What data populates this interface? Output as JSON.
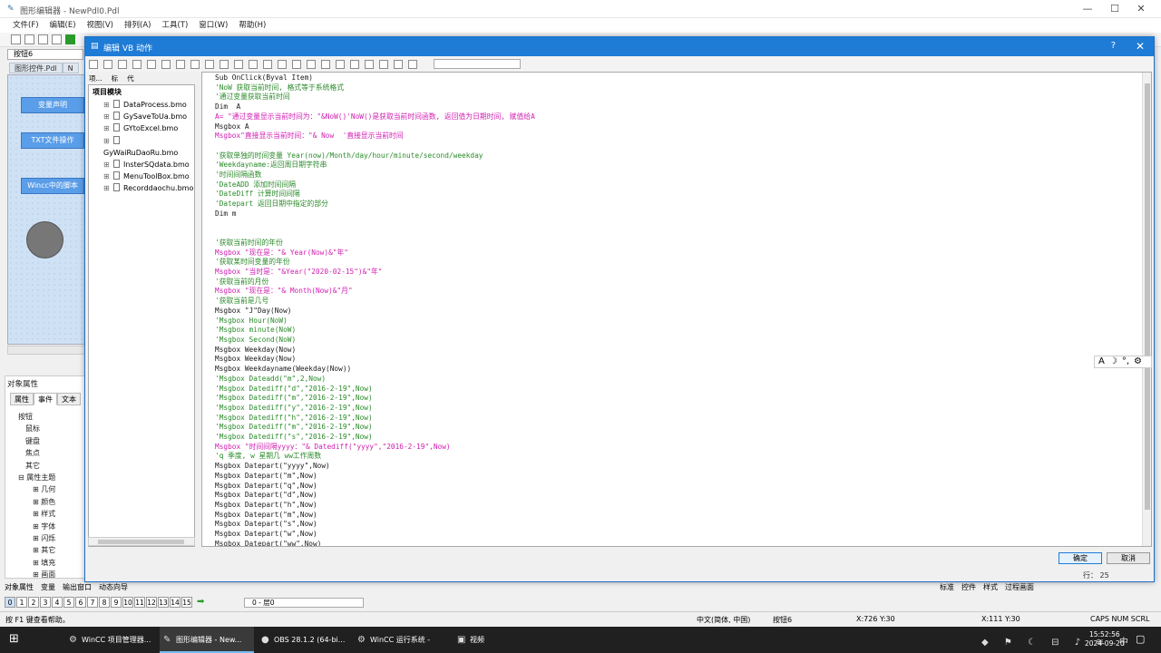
{
  "app": {
    "title": "图形编辑器 - NewPdl0.Pdl",
    "controls": {
      "minimize": "—",
      "maximize": "☐",
      "close": "✕"
    }
  },
  "menu": [
    "文件(F)",
    "编辑(E)",
    "视图(V)",
    "排列(A)",
    "工具(T)",
    "窗口(W)",
    "帮助(H)"
  ],
  "object_combo": "按钮6",
  "doc_tabs": [
    "图形控件.Pdl",
    "N"
  ],
  "canvas": {
    "buttons": [
      "变量声明",
      "TXT文件操作",
      "Wincc中的脚本"
    ]
  },
  "properties": {
    "title": "对象属性",
    "tabs": [
      "属性",
      "事件",
      "文本"
    ],
    "tree": [
      {
        "label": "按钮",
        "level": 1
      },
      {
        "label": "鼠标",
        "level": 2
      },
      {
        "label": "键盘",
        "level": 2
      },
      {
        "label": "焦点",
        "level": 2
      },
      {
        "label": "其它",
        "level": 2
      },
      {
        "label": "属性主题",
        "level": 1
      },
      {
        "label": "几何",
        "level": 3
      },
      {
        "label": "颜色",
        "level": 3
      },
      {
        "label": "样式",
        "level": 3
      },
      {
        "label": "字体",
        "level": 3
      },
      {
        "label": "闪烁",
        "level": 3
      },
      {
        "label": "其它",
        "level": 3
      },
      {
        "label": "填充",
        "level": 3
      },
      {
        "label": "画面",
        "level": 3
      }
    ]
  },
  "dialog": {
    "title": "编辑 VB 动作",
    "help": "?",
    "close": "✕",
    "tree_tabs": [
      "项...",
      "标",
      "代"
    ],
    "tree_root": "项目模块",
    "modules": [
      "DataProcess.bmo",
      "GySaveToUa.bmo",
      "GYtoExcel.bmo",
      "GyWaiRuDaoRu.bmo",
      "InsterSQdata.bmo",
      "MenuToolBox.bmo",
      "Recorddaochu.bmo"
    ],
    "code": [
      {
        "t": "Sub OnClick(Byval Item)",
        "c": "code"
      },
      {
        "t": "'NoW 获取当前时间, 格式等于系统格式",
        "c": "comment"
      },
      {
        "t": "'通过变量获取当前时间",
        "c": "comment"
      },
      {
        "t": "Dim  A",
        "c": "code"
      },
      {
        "t": "A= \"通过变量显示当前时间为：\"&NoW()'NoW()是获取当前时间函数, 返回值为日期时间, 赋值给A",
        "c": "string"
      },
      {
        "t": "Msgbox A",
        "c": "code"
      },
      {
        "t": "Msgbox\"直接显示当前时间：\"& Now  '直接显示当前时间",
        "c": "string"
      },
      {
        "t": "",
        "c": "blank"
      },
      {
        "t": "'获取单独的时间变量 Year(now)/Month/day/hour/minute/second/weekday",
        "c": "comment"
      },
      {
        "t": "'Weekdayname:返回周日期字符串",
        "c": "comment"
      },
      {
        "t": "'时间间隔函数",
        "c": "comment"
      },
      {
        "t": "'DateADD 添加时间间隔",
        "c": "comment"
      },
      {
        "t": "'DateDiff 计算时间间隔",
        "c": "comment"
      },
      {
        "t": "'Datepart 返回日期中指定的部分",
        "c": "comment"
      },
      {
        "t": "Dim m",
        "c": "code"
      },
      {
        "t": "",
        "c": "blank"
      },
      {
        "t": "",
        "c": "blank"
      },
      {
        "t": "'获取当前时间的年份",
        "c": "comment"
      },
      {
        "t": "Msgbox \"现在是：\"& Year(Now)&\"年\"",
        "c": "string"
      },
      {
        "t": "'获取某时间变量的年份",
        "c": "comment"
      },
      {
        "t": "Msgbox \"当时是：\"&Year(\"2020-02-15\")&\"年\"",
        "c": "string"
      },
      {
        "t": "'获取当前的月份",
        "c": "comment"
      },
      {
        "t": "Msgbox \"现在是：\"& Month(Now)&\"月\"",
        "c": "string"
      },
      {
        "t": "'获取当前是几号",
        "c": "comment"
      },
      {
        "t": "Msgbox \"J\"Day(Now)",
        "c": "code"
      },
      {
        "t": "'Msgbox Hour(NoW)",
        "c": "comment"
      },
      {
        "t": "'Msgbox minute(NoW)",
        "c": "comment"
      },
      {
        "t": "'Msgbox Second(NoW)",
        "c": "comment"
      },
      {
        "t": "Msgbox Weekday(Now)",
        "c": "code"
      },
      {
        "t": "Msgbox Weekday(Now)",
        "c": "code"
      },
      {
        "t": "Msgbox Weekdayname(Weekday(Now))",
        "c": "code"
      },
      {
        "t": "'Msgbox Dateadd(\"m\",2,Now)",
        "c": "comment"
      },
      {
        "t": "'Msgbox Datediff(\"d\",\"2016-2-19\",Now)",
        "c": "comment"
      },
      {
        "t": "'Msgbox Datediff(\"m\",\"2016-2-19\",Now)",
        "c": "comment"
      },
      {
        "t": "'Msgbox Datediff(\"y\",\"2016-2-19\",Now)",
        "c": "comment"
      },
      {
        "t": "'Msgbox Datediff(\"h\",\"2016-2-19\",Now)",
        "c": "comment"
      },
      {
        "t": "'Msgbox Datediff(\"m\",\"2016-2-19\",Now)",
        "c": "comment"
      },
      {
        "t": "'Msgbox Datediff(\"s\",\"2016-2-19\",Now)",
        "c": "comment"
      },
      {
        "t": "Msgbox \"时间间隔yyyy：\"& Datediff(\"yyyy\",\"2016-2-19\",Now)",
        "c": "string"
      },
      {
        "t": "'q 季度, w 星期几 ww工作周数",
        "c": "comment"
      },
      {
        "t": "Msgbox Datepart(\"yyyy\",Now)",
        "c": "code"
      },
      {
        "t": "Msgbox Datepart(\"m\",Now)",
        "c": "code"
      },
      {
        "t": "Msgbox Datepart(\"q\",Now)",
        "c": "code"
      },
      {
        "t": "Msgbox Datepart(\"d\",Now)",
        "c": "code"
      },
      {
        "t": "Msgbox Datepart(\"h\",Now)",
        "c": "code"
      },
      {
        "t": "Msgbox Datepart(\"m\",Now)",
        "c": "code"
      },
      {
        "t": "Msgbox Datepart(\"s\",Now)",
        "c": "code"
      },
      {
        "t": "Msgbox Datepart(\"w\",Now)",
        "c": "code"
      },
      {
        "t": "Msgbox Datepart(\"ww\",Now)",
        "c": "code"
      }
    ],
    "ok": "确定",
    "cancel": "取消",
    "status": "行：  25"
  },
  "ime": [
    "A",
    "☽",
    "°,",
    "⚙"
  ],
  "bottom_tabs": [
    "对象属性",
    "变量",
    "输出窗口",
    "动态向导"
  ],
  "right_tabs": [
    "标准",
    "控件",
    "样式",
    "过程画面"
  ],
  "layers": [
    "0",
    "1",
    "2",
    "3",
    "4",
    "5",
    "6",
    "7",
    "8",
    "9",
    "10",
    "11",
    "12",
    "13",
    "14",
    "15"
  ],
  "layer_combo": "0 - 层0",
  "statusbar": {
    "help": "按 F1 键查看帮助。",
    "lang": "中文(简体, 中国)",
    "object": "按钮6",
    "pos1": "X:726 Y:30",
    "pos2": "X:111 Y:30",
    "keys": "CAPS  NUM  SCRL"
  },
  "taskbar": {
    "start": "⊞",
    "apps": [
      {
        "label": "WinCC 项目管理器...",
        "icon": "⚙"
      },
      {
        "label": "图形编辑器 - New...",
        "icon": "✎"
      },
      {
        "label": "OBS 28.1.2 (64-bi...",
        "icon": "●"
      },
      {
        "label": "WinCC 运行系统 -",
        "icon": "⚙"
      },
      {
        "label": "视频",
        "icon": "▣"
      }
    ],
    "tray": "◆ ⚑ ☾ ⊟ ♪ ≋ 中",
    "time": "15:52:56",
    "date": "2024-09-20",
    "notif": "▢"
  }
}
